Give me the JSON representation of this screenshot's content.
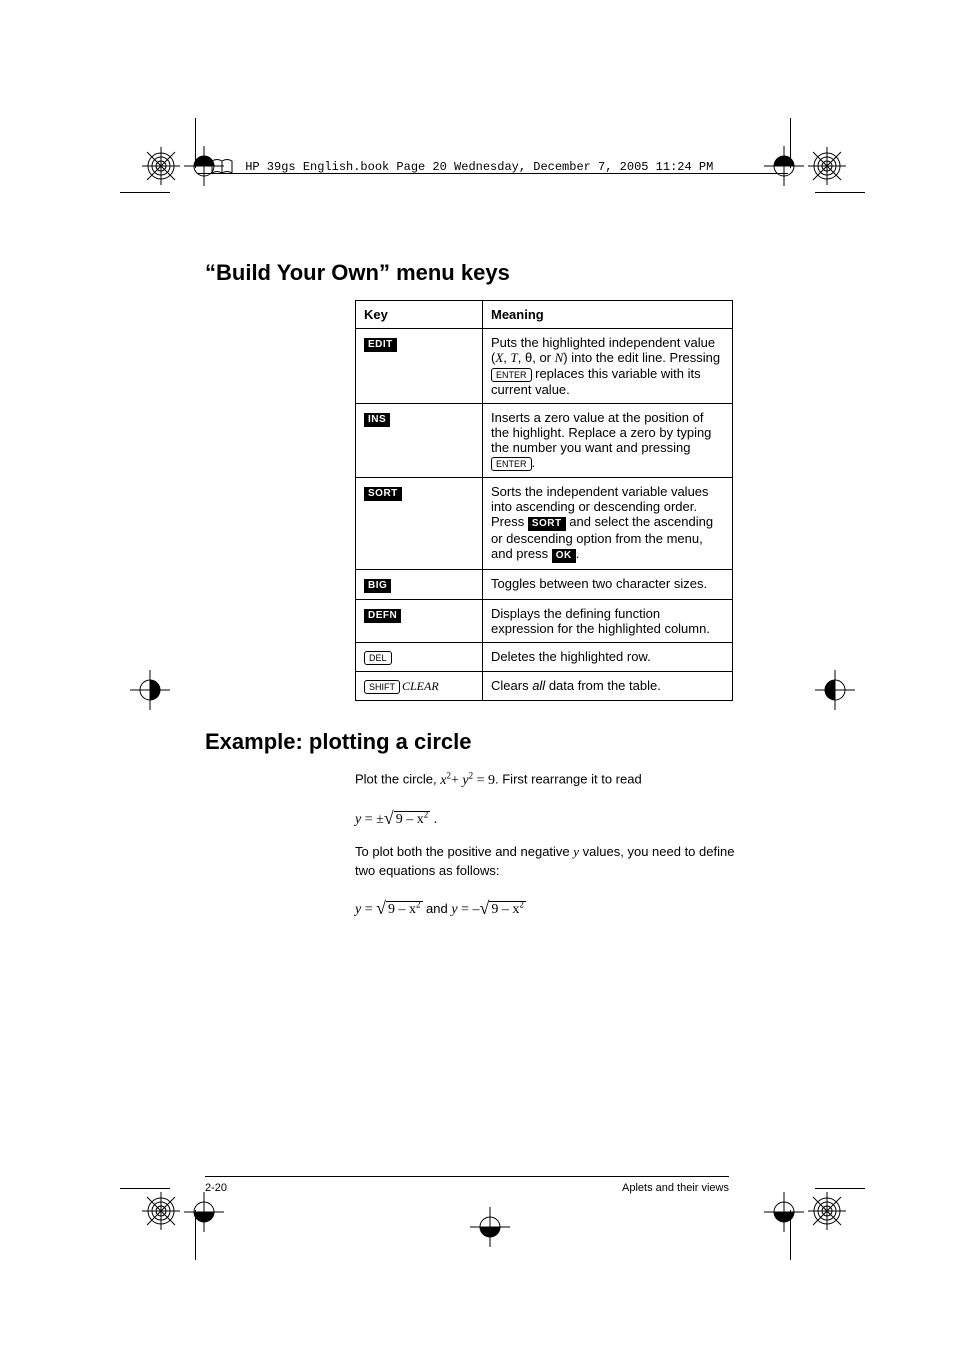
{
  "print_meta": "HP 39gs English.book  Page 20  Wednesday, December 7, 2005  11:24 PM",
  "section1_title": "“Build Your Own” menu keys",
  "table": {
    "head_key": "Key",
    "head_meaning": "Meaning",
    "rows": [
      {
        "key_soft": "EDIT",
        "meaning_before": "Puts the highlighted independent value (",
        "var1": "X",
        "sep1": ", ",
        "var2": "T",
        "sep2": ", θ, or ",
        "var3": "N",
        "meaning_mid": ") into the edit line. Pressing ",
        "hardkey": "ENTER",
        "meaning_after": " replaces this variable with its current value."
      },
      {
        "key_soft": "INS",
        "meaning_before": "Inserts a zero value at the position of the highlight. Replace a zero by typing the number you want and pressing ",
        "hardkey": "ENTER",
        "meaning_after": "."
      },
      {
        "key_soft": "SORT",
        "meaning_before": "Sorts the independent variable values into ascending or descending order. Press ",
        "softkey_inline": "SORT",
        "meaning_mid": " and select the ascending or descending option from the menu, and press ",
        "softkey_inline2": "OK",
        "meaning_after": "."
      },
      {
        "key_soft": "BIG",
        "meaning_before": "Toggles between two character sizes."
      },
      {
        "key_soft": "DEFN",
        "meaning_before": "Displays the defining function expression for the highlighted column."
      },
      {
        "key_hard": "DEL",
        "meaning_before": "Deletes the highlighted row."
      },
      {
        "key_hard": "SHIFT",
        "key_shift_label": "CLEAR",
        "meaning_before1": "Clears ",
        "meaning_ital": "all",
        "meaning_before2": " data from the table."
      }
    ]
  },
  "section2_title": "Example: plotting a circle",
  "example": {
    "line1_a": "Plot the circle, ",
    "eq1_lhs": "x",
    "eq1_sup1": "2",
    "eq1_plus": "+ ",
    "eq1_y": "y",
    "eq1_sup2": "2",
    "eq1_rhs": " = 9",
    "line1_b": ". First rearrange it to read",
    "eq2_y": "y",
    "eq2_eq": " = ",
    "eq2_pm": "±",
    "eq2_rad": "9 – x",
    "eq2_sup": "2",
    "eq2_dot": " .",
    "line2_a": "To plot both the positive and negative ",
    "line2_y": "y",
    "line2_b": " values, you need to define two equations as follows:",
    "eq3_y": "y",
    "eq3_eq": " = ",
    "eq3_rad": "9 – x",
    "eq3_sup": "2",
    "and": " and ",
    "eq4_y": "y",
    "eq4_eq": " = ",
    "eq4_neg": "–",
    "eq4_rad": "9 – x",
    "eq4_sup": "2"
  },
  "footer": {
    "page": "2-20",
    "chapter": "Aplets and their views"
  }
}
